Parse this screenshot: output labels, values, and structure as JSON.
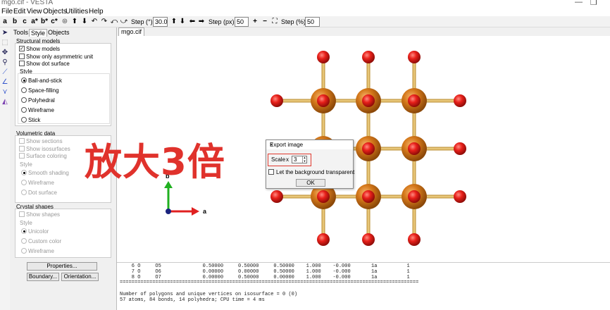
{
  "window": {
    "title": "mgo.cif - VESTA"
  },
  "menu": [
    "File",
    "Edit",
    "View",
    "Objects",
    "Utilities",
    "Help"
  ],
  "toolbar": {
    "axis_buttons": [
      "a",
      "b",
      "c",
      "a*",
      "b*",
      "c*"
    ],
    "step_deg_label": "Step (°):",
    "step_deg_value": "30.0",
    "step_px_label": "Step (px):",
    "step_px_value": "50",
    "step_pct_label": "Step (%):",
    "step_pct_value": "50"
  },
  "tabs": [
    "Tools",
    "Style",
    "Objects"
  ],
  "active_tab": "Style",
  "structural_models": {
    "heading": "Structural models",
    "checkboxes": [
      {
        "label": "Show models",
        "checked": true
      },
      {
        "label": "Show only asymmetric unit",
        "checked": false
      },
      {
        "label": "Show dot surface",
        "checked": false
      }
    ],
    "style_heading": "Style",
    "styles": [
      {
        "label": "Ball-and-stick",
        "selected": true
      },
      {
        "label": "Space-filling",
        "selected": false
      },
      {
        "label": "Polyhedral",
        "selected": false
      },
      {
        "label": "Wireframe",
        "selected": false
      },
      {
        "label": "Stick",
        "selected": false
      }
    ]
  },
  "volumetric_data": {
    "heading": "Volumetric data",
    "checkboxes": [
      "Show sections",
      "Show isosurfaces",
      "Surface coloring"
    ],
    "style_heading": "Style",
    "styles": [
      "Smooth shading",
      "Wireframe",
      "Dot surface"
    ]
  },
  "crystal_shapes": {
    "heading": "Crystal shapes",
    "checkbox": "Show shapes",
    "style_heading": "Style",
    "styles": [
      "Unicolor",
      "Custom color",
      "Wireframe"
    ]
  },
  "buttons": {
    "properties": "Properties...",
    "boundary": "Boundary...",
    "orientation": "Orientation..."
  },
  "document_tab": "mgo.cif",
  "axes": {
    "a": "a",
    "b": "b"
  },
  "overlay_text": "放大3倍",
  "dialog": {
    "title": "Export image",
    "close": "×",
    "scale_label": "Scale",
    "scale_x": "x",
    "scale_value": "3",
    "checkbox_label": "Let the background transparent",
    "ok": "OK"
  },
  "console": {
    "rows": [
      "    6 O     O5              0.50000     0.50000     0.50000    1.000    -0.000       1a          1",
      "    7 O     O6              0.00000     0.00000     0.50000    1.000    -0.000       1a          1",
      "    8 O     O7              0.00000     0.50000     0.00000    1.000    -0.000       1a          1",
      "=====================================================================================================",
      "",
      "Number of polygons and unique vertices on isosurface = 0 (0)",
      "57 atoms, 84 bonds, 14 polyhedra; CPU time = 4 ms"
    ]
  },
  "colors": {
    "oxygen": "#e8201a",
    "magnesium": "#d4781a",
    "bond": "#e0b860",
    "axis_a": "#e02020",
    "axis_b": "#20b020",
    "overlay": "#e0322c"
  }
}
